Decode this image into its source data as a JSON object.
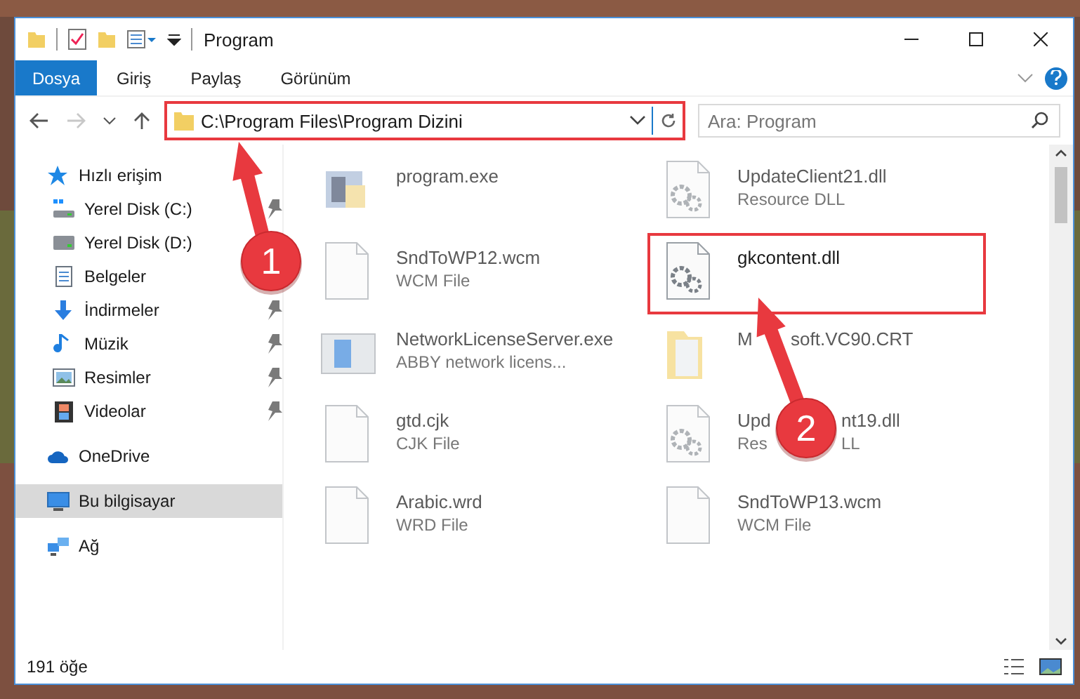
{
  "window": {
    "title": "Program"
  },
  "ribbon_tabs": [
    {
      "label": "Dosya",
      "selected": true
    },
    {
      "label": "Giriş",
      "selected": false
    },
    {
      "label": "Paylaş",
      "selected": false
    },
    {
      "label": "Görünüm",
      "selected": false
    }
  ],
  "address": {
    "path": "C:\\Program Files\\Program Dizini",
    "highlighted": true
  },
  "search": {
    "placeholder": "Ara: Program"
  },
  "nav": [
    {
      "label": "Hızlı erişim",
      "kind": "star",
      "selected": false,
      "children": [
        {
          "label": "Yerel Disk (C:)",
          "kind": "drive-c",
          "pinned": true,
          "selected": false
        },
        {
          "label": "Yerel Disk (D:)",
          "kind": "drive",
          "selected": false
        },
        {
          "label": "Belgeler",
          "kind": "documents",
          "selected": false
        },
        {
          "label": "İndirmeler",
          "kind": "downloads",
          "pinned": true,
          "selected": false
        },
        {
          "label": "Müzik",
          "kind": "music",
          "pinned": true,
          "selected": false
        },
        {
          "label": "Resimler",
          "kind": "pictures",
          "pinned": true,
          "selected": false
        },
        {
          "label": "Videolar",
          "kind": "videos",
          "pinned": true,
          "selected": false
        }
      ]
    },
    {
      "label": "OneDrive",
      "kind": "cloud",
      "selected": false
    },
    {
      "label": "Bu bilgisayar",
      "kind": "computer",
      "selected": true
    },
    {
      "label": "Ağ",
      "kind": "network",
      "selected": false
    }
  ],
  "files": [
    {
      "name": "program.exe",
      "kind": "exe",
      "blurred": true,
      "highlighted": false
    },
    {
      "name": "UpdateClient21.dll",
      "type": "Resource DLL",
      "kind": "dll",
      "blurred": true,
      "highlighted": false
    },
    {
      "name": "SndToWP12.wcm",
      "type": "WCM File",
      "kind": "file",
      "blurred": true,
      "highlighted": false
    },
    {
      "name": "gkcontent.dll",
      "kind": "dll",
      "blurred": false,
      "highlighted": true
    },
    {
      "name": "NetworkLicenseServer.exe",
      "type": "ABBY network licens...",
      "kind": "app",
      "blurred": true,
      "highlighted": false
    },
    {
      "name": [
        "M",
        "soft.VC90.CRT"
      ],
      "kind": "folder",
      "blurred": true,
      "highlighted": false
    },
    {
      "name": "gtd.cjk",
      "type": "CJK File",
      "kind": "file",
      "blurred": true,
      "highlighted": false
    },
    {
      "name": [
        "Upd",
        "nt19.dll"
      ],
      "type": [
        "Res",
        "LL"
      ],
      "kind": "dll",
      "blurred": true,
      "highlighted": false
    },
    {
      "name": "Arabic.wrd",
      "type": "WRD File",
      "kind": "file",
      "blurred": true,
      "highlighted": false
    },
    {
      "name": "SndToWP13.wcm",
      "type": "WCM File",
      "kind": "file",
      "blurred": true,
      "highlighted": false
    }
  ],
  "status_bar": {
    "count": "191 öğe"
  },
  "annotations": [
    {
      "number": "1"
    },
    {
      "number": "2"
    }
  ]
}
